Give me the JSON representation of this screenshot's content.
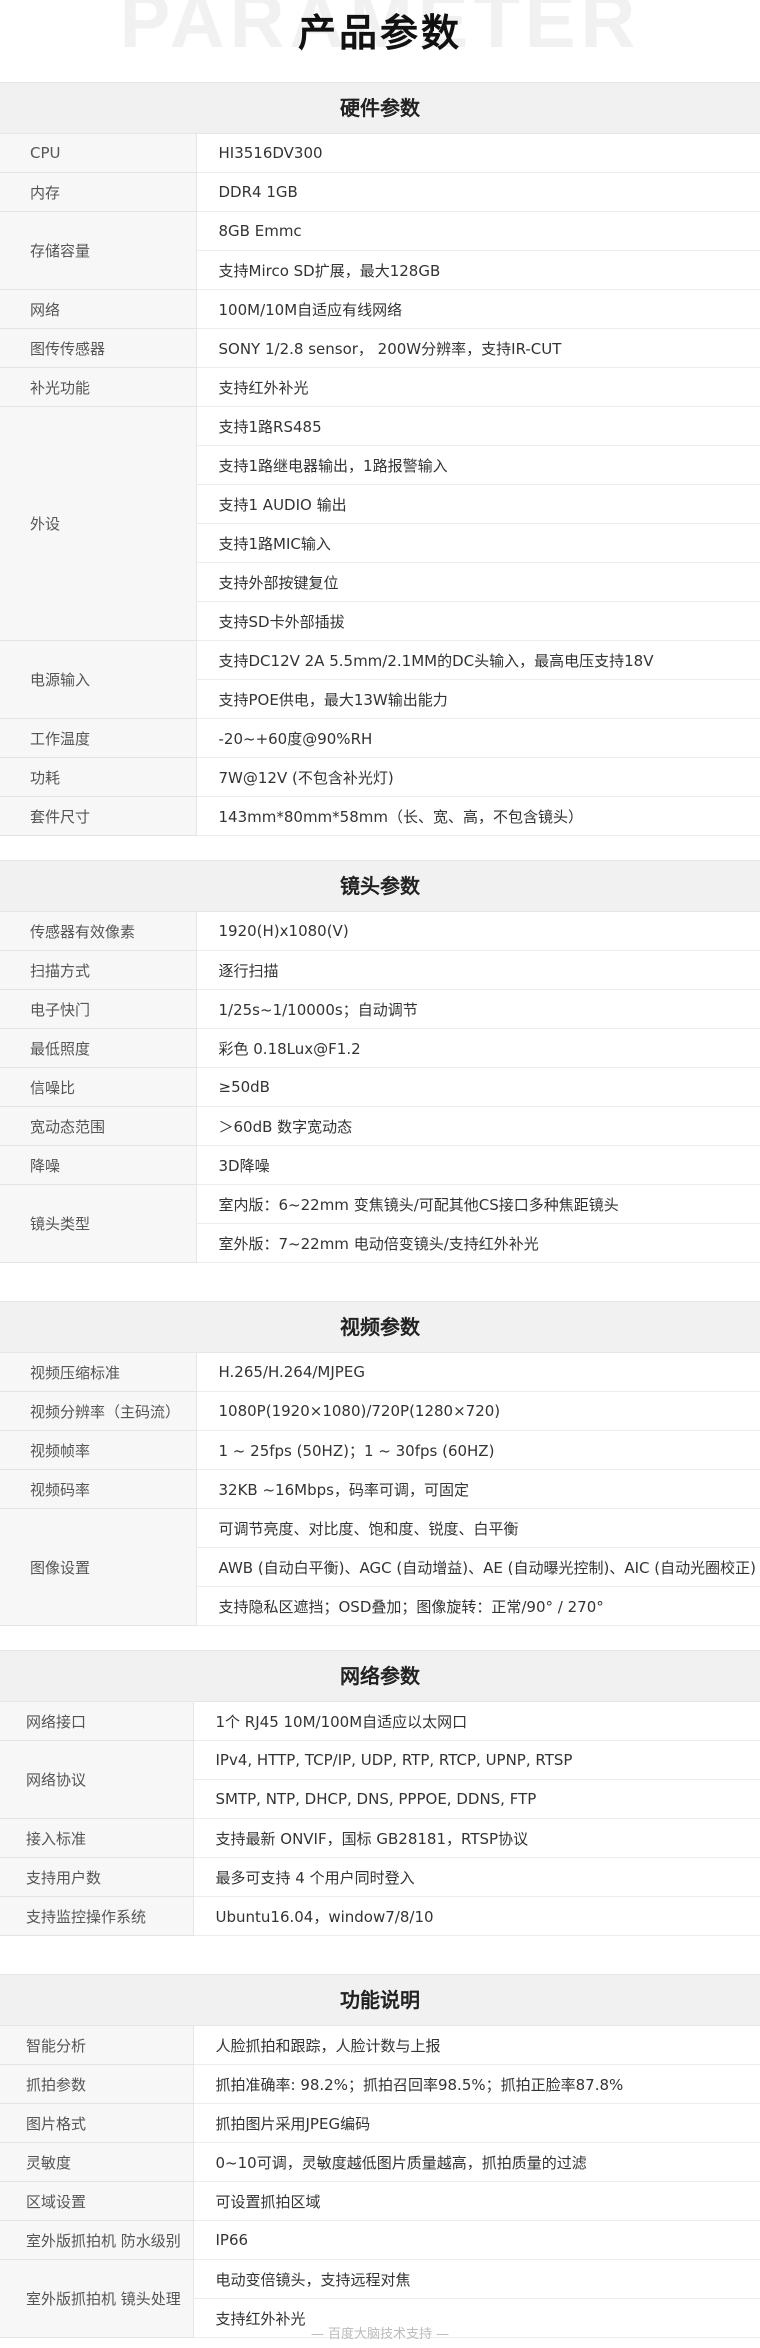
{
  "page": {
    "watermark": "PARAMETER",
    "title": "产品参数",
    "footer": "— 百度大脑技术支持 —"
  },
  "sections": [
    {
      "title": "硬件参数",
      "rows": [
        {
          "label": "CPU",
          "values": [
            "HI3516DV300"
          ]
        },
        {
          "label": "内存",
          "values": [
            "DDR4 1GB"
          ]
        },
        {
          "label": "存储容量",
          "values": [
            "8GB Emmc",
            "支持Mirco SD扩展，最大128GB"
          ]
        },
        {
          "label": "网络",
          "values": [
            "100M/10M自适应有线网络"
          ]
        },
        {
          "label": "图传传感器",
          "values": [
            "SONY 1/2.8 sensor， 200W分辨率，支持IR-CUT"
          ]
        },
        {
          "label": "补光功能",
          "values": [
            "支持红外补光"
          ]
        },
        {
          "label": "外设",
          "values": [
            "支持1路RS485",
            "支持1路继电器输出，1路报警输入",
            "支持1 AUDIO 输出",
            "支持1路MIC输入",
            "支持外部按键复位",
            "支持SD卡外部插拔"
          ]
        },
        {
          "label": "电源输入",
          "values": [
            "支持DC12V 2A 5.5mm/2.1MM的DC头输入，最高电压支持18V",
            "支持POE供电，最大13W输出能力"
          ]
        },
        {
          "label": "工作温度",
          "values": [
            "-20~+60度@90%RH"
          ]
        },
        {
          "label": "功耗",
          "values": [
            "7W@12V (不包含补光灯)"
          ]
        },
        {
          "label": "套件尺寸",
          "values": [
            "143mm*80mm*58mm（长、宽、高，不包含镜头）"
          ]
        }
      ]
    },
    {
      "title": "镜头参数",
      "rows": [
        {
          "label": "传感器有效像素",
          "values": [
            "1920(H)x1080(V)"
          ]
        },
        {
          "label": "扫描方式",
          "values": [
            "逐行扫描"
          ]
        },
        {
          "label": "电子快门",
          "values": [
            "1/25s~1/10000s；自动调节"
          ]
        },
        {
          "label": "最低照度",
          "values": [
            "彩色 0.18Lux@F1.2"
          ]
        },
        {
          "label": "信噪比",
          "values": [
            "≥50dB"
          ]
        },
        {
          "label": "宽动态范围",
          "values": [
            "＞60dB 数字宽动态"
          ]
        },
        {
          "label": "降噪",
          "values": [
            "3D降噪"
          ]
        },
        {
          "label": "镜头类型",
          "values": [
            "室内版：6~22mm 变焦镜头/可配其他CS接口多种焦距镜头",
            "室外版：7~22mm 电动倍变镜头/支持红外补光"
          ]
        }
      ]
    },
    {
      "title": "视频参数",
      "rows": [
        {
          "label": "视频压缩标准",
          "values": [
            "H.265/H.264/MJPEG"
          ]
        },
        {
          "label": "视频分辨率（主码流）",
          "values": [
            "1080P(1920×1080)/720P(1280×720)"
          ]
        },
        {
          "label": "视频帧率",
          "values": [
            "1 ~ 25fps (50HZ)；1 ~ 30fps (60HZ)"
          ]
        },
        {
          "label": "视频码率",
          "values": [
            "32KB ~16Mbps，码率可调，可固定"
          ]
        },
        {
          "label": "图像设置",
          "values": [
            "可调节亮度、对比度、饱和度、锐度、白平衡",
            "AWB (自动白平衡)、AGC (自动增益)、AE (自动曝光控制)、AIC (自动光圈校正)",
            "支持隐私区遮挡；OSD叠加；图像旋转：正常/90° / 270°"
          ]
        }
      ]
    },
    {
      "title": "网络参数",
      "rows": [
        {
          "label": "网络接口",
          "values": [
            "1个 RJ45 10M/100M自适应以太网口"
          ]
        },
        {
          "label": "网络协议",
          "values": [
            "IPv4, HTTP, TCP/IP, UDP, RTP, RTCP, UPNP, RTSP",
            "SMTP, NTP, DHCP, DNS, PPPOE, DDNS, FTP"
          ]
        },
        {
          "label": "接入标准",
          "values": [
            "支持最新 ONVIF，国标 GB28181，RTSP协议"
          ]
        },
        {
          "label": "支持用户数",
          "values": [
            "最多可支持 4 个用户同时登入"
          ]
        },
        {
          "label": "支持监控操作系统",
          "values": [
            "Ubuntu16.04，window7/8/10"
          ]
        }
      ]
    },
    {
      "title": "功能说明",
      "rows": [
        {
          "label": "智能分析",
          "values": [
            "人脸抓拍和跟踪，人脸计数与上报"
          ]
        },
        {
          "label": "抓拍参数",
          "values": [
            "抓拍准确率: 98.2%；抓拍召回率98.5%；抓拍正脸率87.8%"
          ]
        },
        {
          "label": "图片格式",
          "values": [
            "抓拍图片采用JPEG编码"
          ]
        },
        {
          "label": "灵敏度",
          "values": [
            "0~10可调，灵敏度越低图片质量越高，抓拍质量的过滤"
          ]
        },
        {
          "label": "区域设置",
          "values": [
            "可设置抓拍区域"
          ]
        },
        {
          "label": "室外版抓拍机 防水级别",
          "values": [
            "IP66"
          ]
        },
        {
          "label": "室外版抓拍机 镜头处理",
          "values": [
            "电动变倍镜头，支持远程对焦",
            "支持红外补光"
          ]
        }
      ]
    }
  ]
}
